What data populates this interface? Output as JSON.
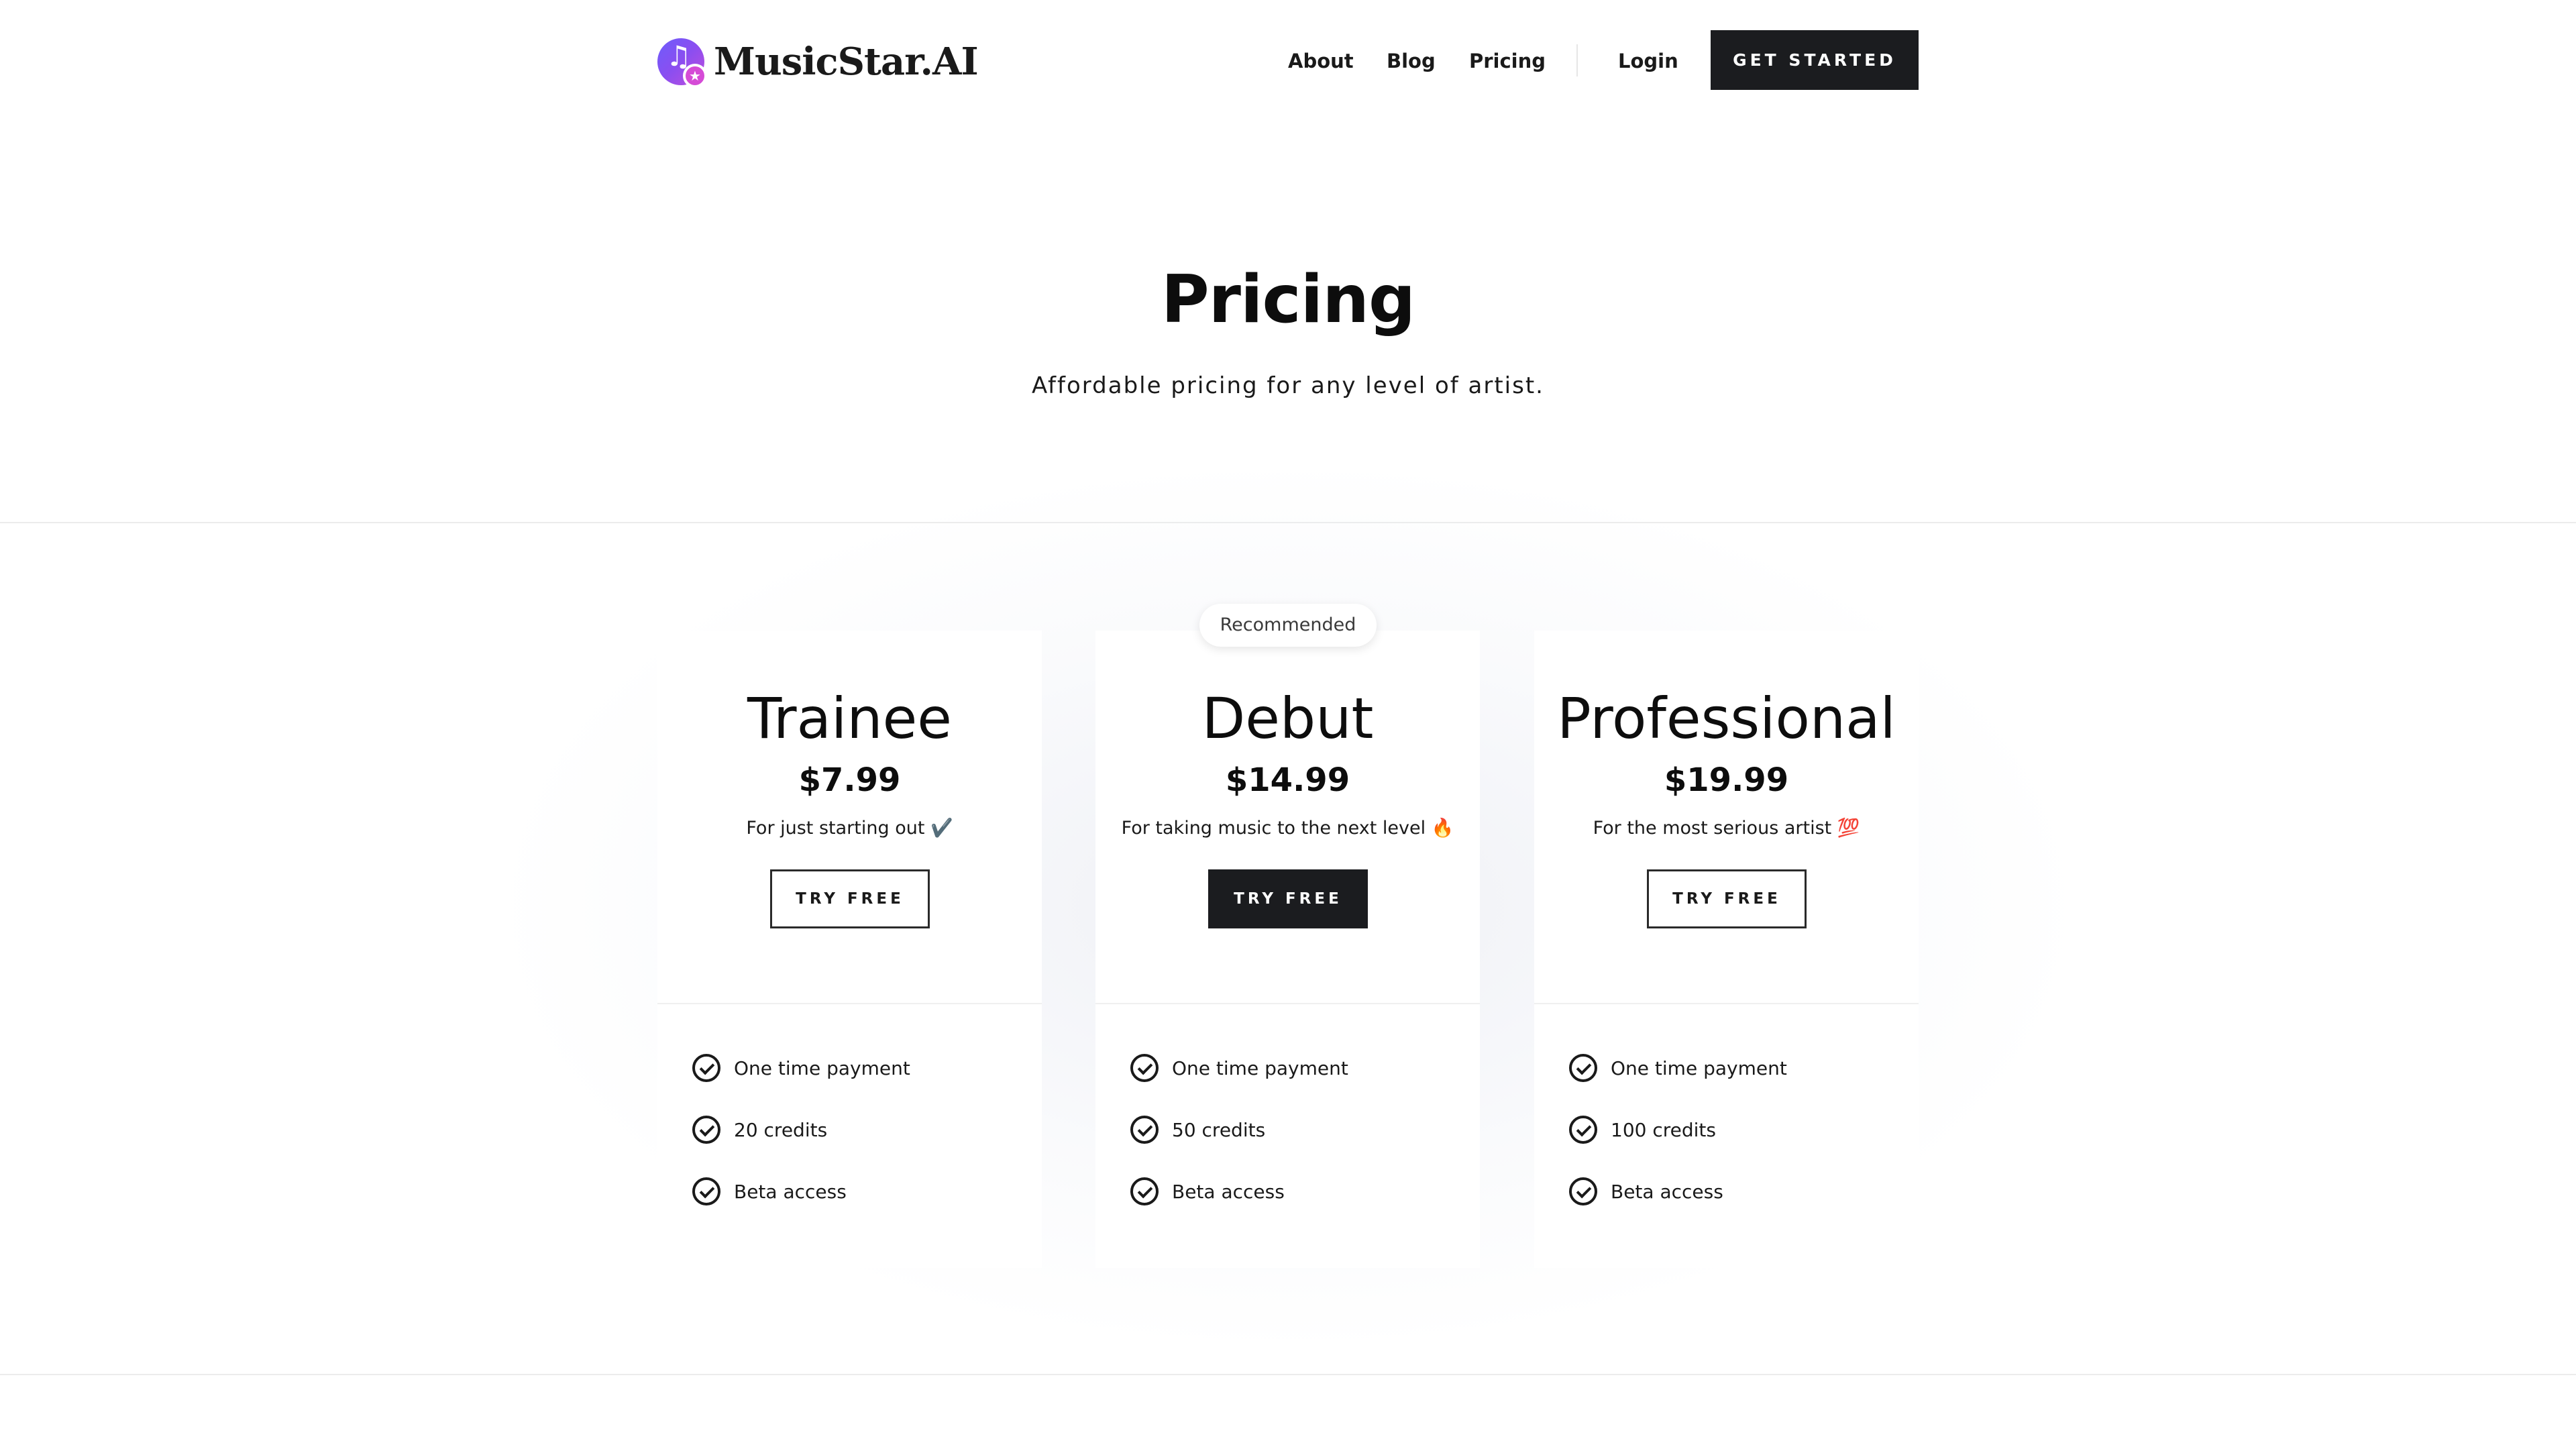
{
  "header": {
    "logo_text": "MusicStar.AI",
    "logo_icon": "music-note-star-icon",
    "nav": [
      {
        "label": "About"
      },
      {
        "label": "Blog"
      },
      {
        "label": "Pricing"
      },
      {
        "label": "Login"
      }
    ],
    "cta_label": "GET STARTED"
  },
  "hero": {
    "title": "Pricing",
    "subtitle": "Affordable pricing for any level of artist."
  },
  "plans": [
    {
      "name": "Trainee",
      "price": "$7.99",
      "description": "For just starting out ✔️",
      "button_label": "TRY FREE",
      "features": [
        "One time payment",
        "20 credits",
        "Beta access"
      ]
    },
    {
      "name": "Debut",
      "badge": "Recommended",
      "price": "$14.99",
      "description": "For taking music to the next level 🔥",
      "button_label": "TRY FREE",
      "features": [
        "One time payment",
        "50 credits",
        "Beta access"
      ]
    },
    {
      "name": "Professional",
      "price": "$19.99",
      "description": "For the most serious artist 💯",
      "button_label": "TRY FREE",
      "features": [
        "One time payment",
        "100 credits",
        "Beta access"
      ]
    }
  ],
  "colors": {
    "primary_dark": "#1b1c1f",
    "logo_gradient_start": "#6d5dfc",
    "logo_gradient_end": "#c04ddd"
  }
}
